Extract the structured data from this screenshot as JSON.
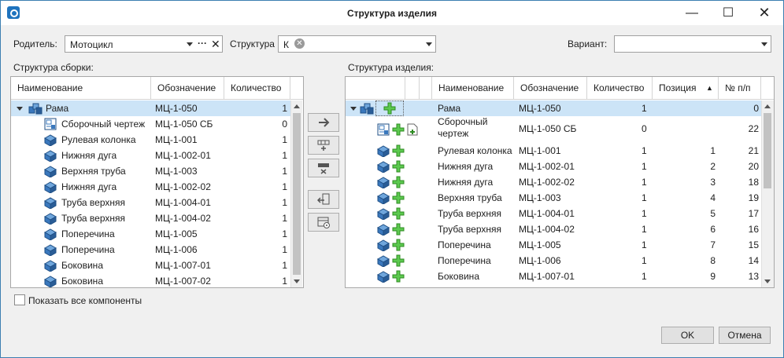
{
  "window": {
    "title": "Структура изделия",
    "minimize": "—",
    "maximize": "☐",
    "close": "✕"
  },
  "top": {
    "parent_label": "Родитель:",
    "parent_value": "Мотоцикл",
    "parent_dots": "···",
    "parent_clear": "✕",
    "structure_label": "Структура",
    "structure_value": "К",
    "variant_label": "Вариант:",
    "variant_value": ""
  },
  "left": {
    "section_label": "Структура сборки:",
    "columns": [
      "Наименование",
      "Обозначение",
      "Количество"
    ],
    "rows": [
      {
        "name": "Рама",
        "code": "МЦ-1-050",
        "qty": "1",
        "icon": "assembly-icon",
        "selected": true,
        "expandable": true
      },
      {
        "name": "Сборочный чертеж",
        "code": "МЦ-1-050 СБ",
        "qty": "0",
        "icon": "drawing-icon"
      },
      {
        "name": "Рулевая колонка",
        "code": "МЦ-1-001",
        "qty": "1",
        "icon": "part-icon"
      },
      {
        "name": "Нижняя дуга",
        "code": "МЦ-1-002-01",
        "qty": "1",
        "icon": "part-icon"
      },
      {
        "name": "Верхняя труба",
        "code": "МЦ-1-003",
        "qty": "1",
        "icon": "part-icon"
      },
      {
        "name": "Нижняя дуга",
        "code": "МЦ-1-002-02",
        "qty": "1",
        "icon": "part-icon"
      },
      {
        "name": "Труба верхняя",
        "code": "МЦ-1-004-01",
        "qty": "1",
        "icon": "part-icon"
      },
      {
        "name": "Труба верхняя",
        "code": "МЦ-1-004-02",
        "qty": "1",
        "icon": "part-icon"
      },
      {
        "name": "Поперечина",
        "code": "МЦ-1-005",
        "qty": "1",
        "icon": "part-icon"
      },
      {
        "name": "Поперечина",
        "code": "МЦ-1-006",
        "qty": "1",
        "icon": "part-icon"
      },
      {
        "name": "Боковина",
        "code": "МЦ-1-007-01",
        "qty": "1",
        "icon": "part-icon"
      },
      {
        "name": "Боковина",
        "code": "МЦ-1-007-02",
        "qty": "1",
        "icon": "part-icon"
      }
    ],
    "show_all_label": "Показать все компоненты"
  },
  "middle_buttons": [
    {
      "name": "add-to-structure-button",
      "icon": "arrow-right-icon"
    },
    {
      "name": "insert-row-button",
      "icon": "table-add-icon"
    },
    {
      "name": "delete-row-button",
      "icon": "table-delete-icon"
    },
    {
      "name": "return-button",
      "icon": "return-doc-icon"
    },
    {
      "name": "settings-table-button",
      "icon": "table-settings-icon"
    }
  ],
  "right": {
    "section_label": "Структура изделия:",
    "columns": [
      "Наименование",
      "Обозначение",
      "Количество",
      "Позиция",
      "№ п/п"
    ],
    "sort_indicator": "▲",
    "rows": [
      {
        "name": "Рама",
        "code": "МЦ-1-050",
        "qty": "1",
        "pos": "",
        "num": "0",
        "icon": "assembly-icon",
        "selected": true
      },
      {
        "name": "Сборочный чертеж",
        "name2": "",
        "code": "МЦ-1-050 СБ",
        "qty": "0",
        "pos": "",
        "num": "22",
        "icon": "drawing-icon"
      },
      {
        "name": "Рулевая колонка",
        "code": "МЦ-1-001",
        "qty": "1",
        "pos": "1",
        "num": "21",
        "icon": "part-icon"
      },
      {
        "name": "Нижняя дуга",
        "code": "МЦ-1-002-01",
        "qty": "1",
        "pos": "2",
        "num": "20",
        "icon": "part-icon"
      },
      {
        "name": "Нижняя дуга",
        "code": "МЦ-1-002-02",
        "qty": "1",
        "pos": "3",
        "num": "18",
        "icon": "part-icon"
      },
      {
        "name": "Верхняя труба",
        "code": "МЦ-1-003",
        "qty": "1",
        "pos": "4",
        "num": "19",
        "icon": "part-icon"
      },
      {
        "name": "Труба верхняя",
        "code": "МЦ-1-004-01",
        "qty": "1",
        "pos": "5",
        "num": "17",
        "icon": "part-icon"
      },
      {
        "name": "Труба верхняя",
        "code": "МЦ-1-004-02",
        "qty": "1",
        "pos": "6",
        "num": "16",
        "icon": "part-icon"
      },
      {
        "name": "Поперечина",
        "code": "МЦ-1-005",
        "qty": "1",
        "pos": "7",
        "num": "15",
        "icon": "part-icon"
      },
      {
        "name": "Поперечина",
        "code": "МЦ-1-006",
        "qty": "1",
        "pos": "8",
        "num": "14",
        "icon": "part-icon"
      },
      {
        "name": "Боковина",
        "code": "МЦ-1-007-01",
        "qty": "1",
        "pos": "9",
        "num": "13",
        "icon": "part-icon"
      }
    ]
  },
  "footer": {
    "ok": "OK",
    "cancel": "Отмена"
  },
  "colors": {
    "selection": "#cce4f7",
    "accent": "#1e73be",
    "plus_green": "#3cb043",
    "part_blue": "#2f6fb5"
  }
}
